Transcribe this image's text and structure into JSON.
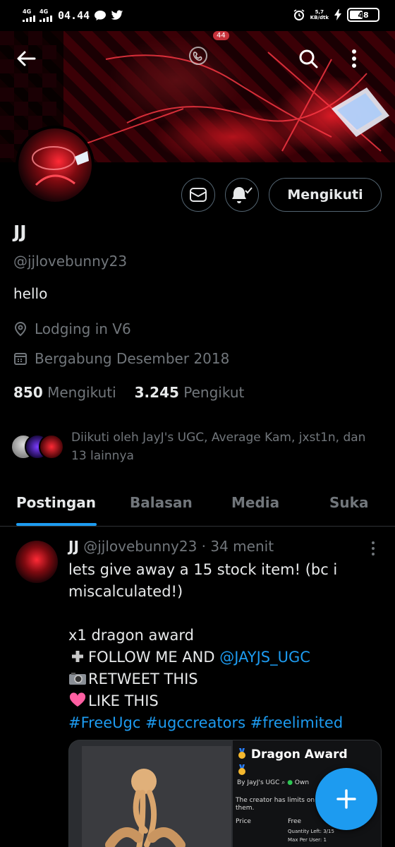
{
  "status_bar": {
    "network1": "4G",
    "network2": "4G",
    "time": "04.44",
    "speed_value": "5,7",
    "speed_unit": "KB/dtk",
    "battery": "48"
  },
  "header": {
    "spaces_badge": "44"
  },
  "profile": {
    "name": "JJ",
    "handle": "@jjlovebunny23",
    "bio": "hello",
    "location": "Lodging in V6",
    "joined": "Bergabung Desember 2018",
    "following_count": "850",
    "following_label": "Mengikuti",
    "followers_count": "3.245",
    "followers_label": "Pengikut",
    "followed_by": "Diikuti oleh JayJ's UGC, Average Kam, jxst1n, dan 13 lainnya",
    "follow_button": "Mengikuti"
  },
  "tabs": [
    {
      "label": "Postingan",
      "active": true
    },
    {
      "label": "Balasan",
      "active": false
    },
    {
      "label": "Media",
      "active": false
    },
    {
      "label": "Suka",
      "active": false
    }
  ],
  "post": {
    "name": "JJ",
    "meta": "@jjlovebunny23 · 34 menit",
    "line1": "lets give away a 15 stock item! (bc i miscalculated!)",
    "line2": "x1 dragon award",
    "line3_prefix": "FOLLOW ME   AND ",
    "line3_mention": "@JAYJS_UGC",
    "line4": "RETWEET THIS",
    "line5": "LIKE THIS",
    "hashtags": "#FreeUgc #ugccreators #freelimited",
    "card": {
      "title": "Dragon Award",
      "by": "By JayJ's UGC",
      "owned": "Own",
      "desc": "The creator has limits on h... purchase from them.",
      "price_label": "Price",
      "price_value": "Free",
      "quantity": "Quantity Left: 3/15",
      "max": "Max Per User: 1"
    }
  },
  "colors": {
    "accent": "#1d9bf0",
    "secondary_text": "#71767b",
    "primary_text": "#e7e9ea",
    "divider": "#2f3336"
  }
}
